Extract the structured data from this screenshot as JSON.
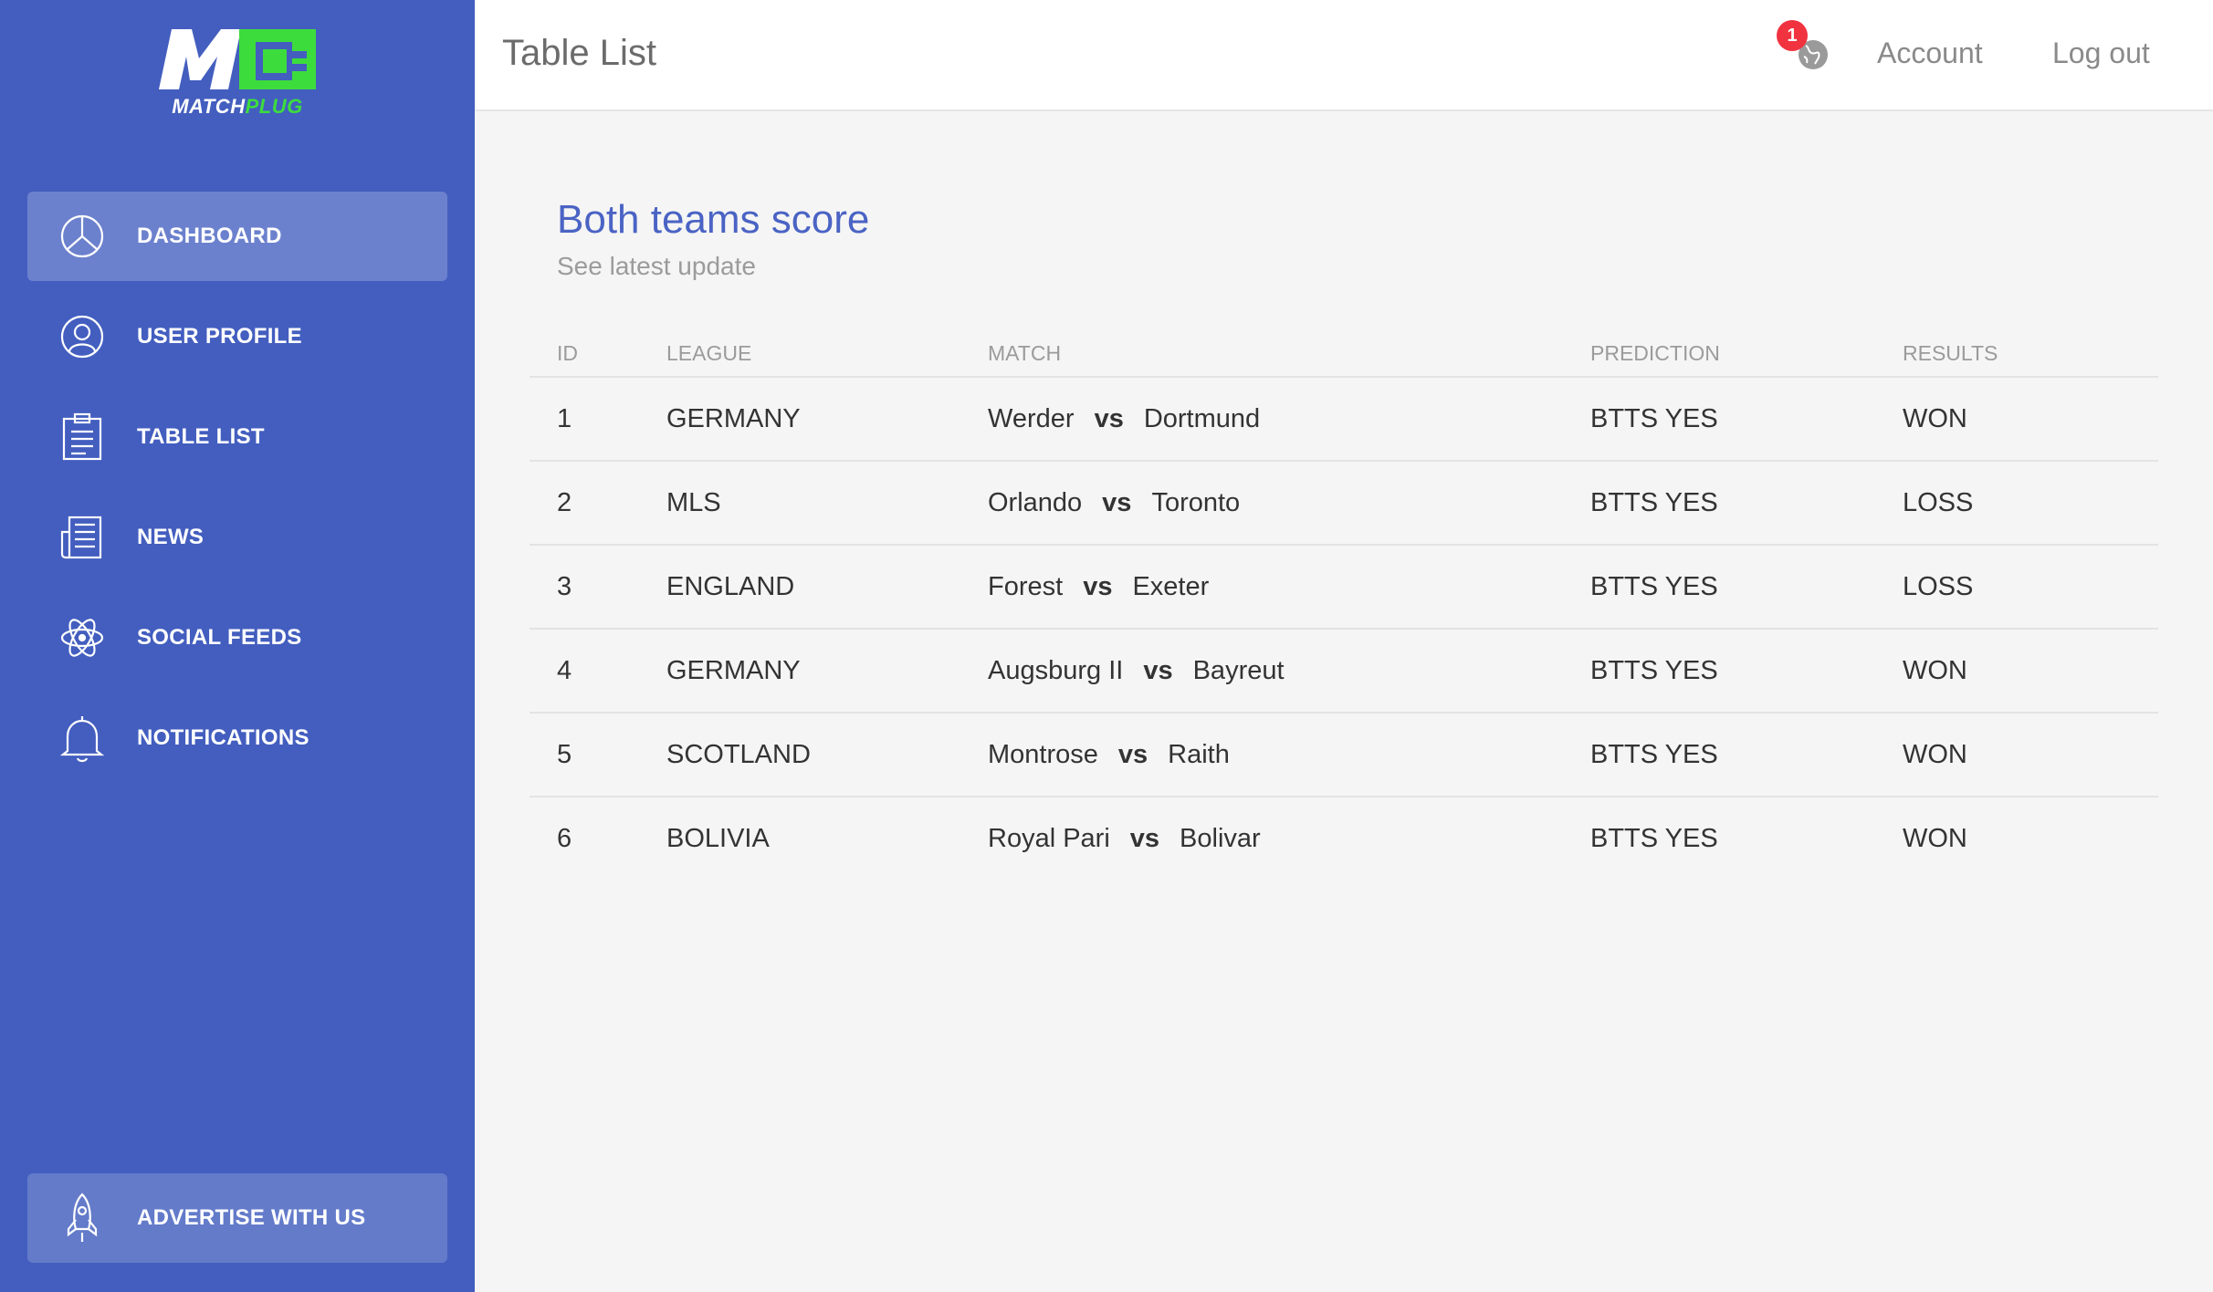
{
  "brand": {
    "name_part1": "MATCH",
    "name_part2": "PLUG",
    "logo_mark": "M",
    "brand_color": "#435ebf",
    "accent_color": "#3ddc3d"
  },
  "sidebar": {
    "items": [
      {
        "label": "DASHBOARD",
        "icon": "pie-chart-icon",
        "active": true
      },
      {
        "label": "USER PROFILE",
        "icon": "user-circle-icon"
      },
      {
        "label": "TABLE LIST",
        "icon": "clipboard-icon"
      },
      {
        "label": "NEWS",
        "icon": "newspaper-icon"
      },
      {
        "label": "SOCIAL FEEDS",
        "icon": "atom-icon"
      },
      {
        "label": "NOTIFICATIONS",
        "icon": "bell-icon"
      }
    ],
    "advertise": {
      "label": "ADVERTISE WITH US",
      "icon": "rocket-icon"
    }
  },
  "header": {
    "title": "Table List",
    "notification_count": "1",
    "account_label": "Account",
    "logout_label": "Log out"
  },
  "card": {
    "title": "Both teams score",
    "subtitle": "See latest update"
  },
  "table": {
    "columns": [
      "ID",
      "LEAGUE",
      "MATCH",
      "PREDICTION",
      "RESULTS"
    ],
    "vs_label": "vs",
    "rows": [
      {
        "id": "1",
        "league": "GERMANY",
        "home": "Werder",
        "away": "Dortmund",
        "prediction": "BTTS YES",
        "result": "WON"
      },
      {
        "id": "2",
        "league": "MLS",
        "home": "Orlando",
        "away": "Toronto",
        "prediction": "BTTS YES",
        "result": "LOSS"
      },
      {
        "id": "3",
        "league": "ENGLAND",
        "home": "Forest",
        "away": "Exeter",
        "prediction": "BTTS YES",
        "result": "LOSS"
      },
      {
        "id": "4",
        "league": "GERMANY",
        "home": "Augsburg II",
        "away": "Bayreut",
        "prediction": "BTTS YES",
        "result": "WON"
      },
      {
        "id": "5",
        "league": "SCOTLAND",
        "home": "Montrose",
        "away": "Raith",
        "prediction": "BTTS YES",
        "result": "WON"
      },
      {
        "id": "6",
        "league": "BOLIVIA",
        "home": "Royal Pari",
        "away": "Bolivar",
        "prediction": "BTTS YES",
        "result": "WON"
      }
    ]
  }
}
